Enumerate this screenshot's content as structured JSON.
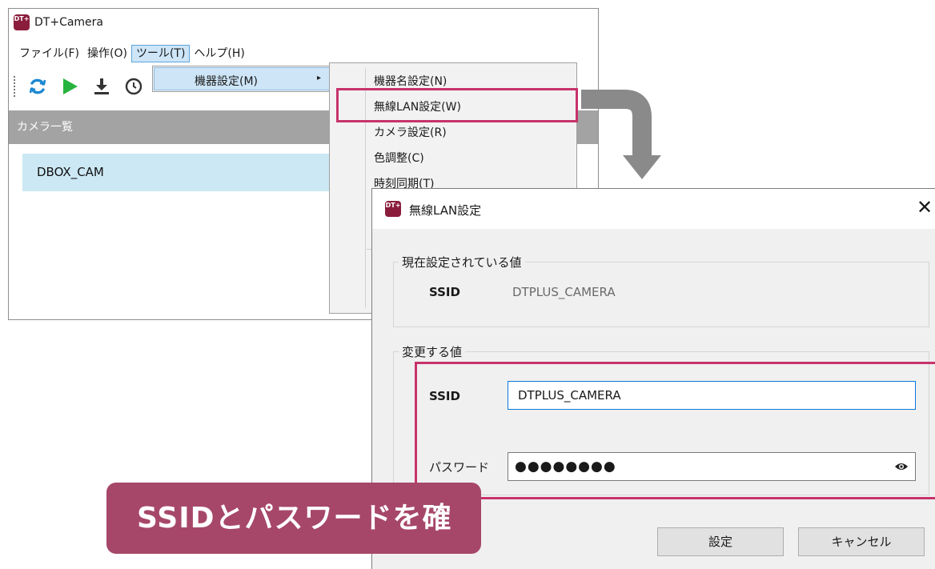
{
  "app": {
    "title": "DT+Camera",
    "logo_text": "DT+"
  },
  "menubar": {
    "items": [
      "ファイル(F)",
      "操作(O)",
      "ツール(T)",
      "ヘルプ(H)"
    ]
  },
  "toolbar": {
    "buttons": [
      "refresh-icon",
      "play-icon",
      "download-icon",
      "clock-icon"
    ]
  },
  "camera_list": {
    "header": "カメラ一覧",
    "rows": [
      "DBOX_CAM"
    ]
  },
  "tool_menu": {
    "items": [
      "機器設定(M)"
    ],
    "arrow": "▸"
  },
  "device_submenu": {
    "items": [
      "機器名設定(N)",
      "無線LAN設定(W)",
      "カメラ設定(R)",
      "色調整(C)",
      "時刻同期(T)"
    ]
  },
  "dialog": {
    "title": "無線LAN設定",
    "close": "✕",
    "current_group": {
      "legend": "現在設定されている値",
      "ssid_label": "SSID",
      "ssid_value": "DTPLUS_CAMERA"
    },
    "change_group": {
      "legend": "変更する値",
      "ssid_label": "SSID",
      "ssid_value": "DTPLUS_CAMERA",
      "password_label": "パスワード",
      "password_masked": "●●●●●●●●"
    },
    "buttons": {
      "ok": "設定",
      "cancel": "キャンセル"
    }
  },
  "callout": {
    "text": "SSIDとパスワードを確認"
  },
  "colors": {
    "highlight": "#c7336a",
    "callout_bg": "#a64769",
    "accent_blue": "#0a78d6",
    "refresh_icon": "#1d88d0",
    "play_icon": "#27b33d"
  }
}
